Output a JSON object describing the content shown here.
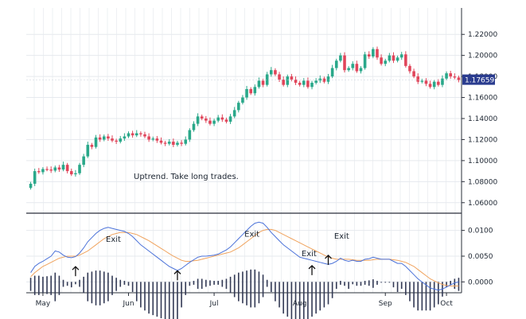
{
  "chart_data": [
    {
      "type": "candlestick",
      "annotation": "Uptrend. Take long trades.",
      "ylim": [
        1.05,
        1.23
      ],
      "yticks": [
        "1.22000",
        "1.20000",
        "1.18000",
        "1.16000",
        "1.14000",
        "1.12000",
        "1.10000",
        "1.08000",
        "1.06000"
      ],
      "yticks_val": [
        1.22,
        1.2,
        1.18,
        1.16,
        1.14,
        1.12,
        1.1,
        1.08,
        1.06
      ],
      "last_price_label": "1.17659",
      "last_price": 1.17659,
      "x_labels": [
        "May",
        "Jun",
        "Jul",
        "Aug",
        "Sep",
        "Oct"
      ],
      "grid": true,
      "colors": {
        "up": "#2aa88a",
        "down": "#e0455a",
        "badge": "#2a3c8f"
      },
      "close": [
        1.078,
        1.09,
        1.089,
        1.092,
        1.0915,
        1.0905,
        1.0935,
        1.0915,
        1.096,
        1.09,
        1.087,
        1.088,
        1.096,
        1.104,
        1.115,
        1.113,
        1.122,
        1.12,
        1.123,
        1.121,
        1.119,
        1.118,
        1.121,
        1.123,
        1.126,
        1.124,
        1.126,
        1.125,
        1.123,
        1.12,
        1.121,
        1.119,
        1.117,
        1.116,
        1.118,
        1.115,
        1.117,
        1.116,
        1.12,
        1.129,
        1.135,
        1.142,
        1.14,
        1.138,
        1.135,
        1.138,
        1.141,
        1.139,
        1.137,
        1.142,
        1.148,
        1.155,
        1.16,
        1.168,
        1.164,
        1.17,
        1.176,
        1.172,
        1.182,
        1.186,
        1.182,
        1.177,
        1.172,
        1.18,
        1.177,
        1.174,
        1.172,
        1.176,
        1.17,
        1.174,
        1.176,
        1.178,
        1.175,
        1.18,
        1.188,
        1.195,
        1.2,
        1.186,
        1.188,
        1.192,
        1.185,
        1.188,
        1.201,
        1.199,
        1.206,
        1.198,
        1.192,
        1.195,
        1.2,
        1.195,
        1.198,
        1.201,
        1.19,
        1.185,
        1.18,
        1.175,
        1.176,
        1.173,
        1.17,
        1.175,
        1.172,
        1.178,
        1.183,
        1.18,
        1.179,
        1.1766
      ],
      "macd_ylim": [
        -0.0018,
        0.0118
      ],
      "macd_yticks": [
        "0.0100",
        "0.0050",
        "0.0000"
      ],
      "macd_yticks_val": [
        0.01,
        0.005,
        0.0
      ],
      "macd_colors": {
        "macd": "#4b72d9",
        "signal": "#f0a35e",
        "hist": "#333a55"
      },
      "macd": [
        0.0018,
        0.003,
        0.0036,
        0.004,
        0.0045,
        0.005,
        0.006,
        0.0058,
        0.0052,
        0.0048,
        0.0047,
        0.0049,
        0.0056,
        0.0066,
        0.0078,
        0.0086,
        0.0094,
        0.01,
        0.0104,
        0.0106,
        0.0104,
        0.0102,
        0.01,
        0.0098,
        0.0094,
        0.0088,
        0.008,
        0.0072,
        0.0066,
        0.006,
        0.0054,
        0.0048,
        0.0042,
        0.0036,
        0.003,
        0.0026,
        0.0022,
        0.0026,
        0.0032,
        0.0038,
        0.0043,
        0.0048,
        0.005,
        0.005,
        0.0051,
        0.0052,
        0.0054,
        0.0058,
        0.0062,
        0.0068,
        0.0076,
        0.0084,
        0.0092,
        0.01,
        0.0108,
        0.0114,
        0.0116,
        0.0114,
        0.0106,
        0.0096,
        0.0088,
        0.008,
        0.0072,
        0.0066,
        0.006,
        0.0054,
        0.0048,
        0.0046,
        0.0044,
        0.0042,
        0.004,
        0.0038,
        0.0036,
        0.0034,
        0.0036,
        0.004,
        0.0046,
        0.0042,
        0.004,
        0.0042,
        0.004,
        0.004,
        0.0044,
        0.0045,
        0.0048,
        0.0046,
        0.0044,
        0.0044,
        0.0044,
        0.004,
        0.0036,
        0.0036,
        0.003,
        0.0022,
        0.0014,
        0.0006,
        0.0,
        -0.0006,
        -0.0012,
        -0.0014,
        -0.0016,
        -0.0014,
        -0.001,
        -0.0006,
        -0.0002,
        0.0
      ],
      "signal": [
        0.001,
        0.0018,
        0.0024,
        0.003,
        0.0034,
        0.0038,
        0.0042,
        0.0046,
        0.0048,
        0.005,
        0.005,
        0.005,
        0.0052,
        0.0056,
        0.006,
        0.0066,
        0.0072,
        0.0078,
        0.0084,
        0.0088,
        0.0092,
        0.0094,
        0.0096,
        0.0096,
        0.0096,
        0.0094,
        0.0092,
        0.0088,
        0.0084,
        0.008,
        0.0075,
        0.007,
        0.0065,
        0.006,
        0.0055,
        0.005,
        0.0046,
        0.0042,
        0.004,
        0.004,
        0.0041,
        0.0042,
        0.0044,
        0.0046,
        0.0048,
        0.005,
        0.0052,
        0.0054,
        0.0056,
        0.0058,
        0.0062,
        0.0066,
        0.0072,
        0.0078,
        0.0084,
        0.009,
        0.0096,
        0.01,
        0.0102,
        0.0102,
        0.01,
        0.0096,
        0.0092,
        0.0088,
        0.0084,
        0.008,
        0.0076,
        0.0072,
        0.0068,
        0.0064,
        0.006,
        0.0056,
        0.0052,
        0.0048,
        0.0046,
        0.0044,
        0.0044,
        0.0044,
        0.0044,
        0.0043,
        0.0042,
        0.0042,
        0.0042,
        0.0042,
        0.0043,
        0.0044,
        0.0044,
        0.0044,
        0.0044,
        0.0043,
        0.0042,
        0.004,
        0.0038,
        0.0034,
        0.003,
        0.0024,
        0.0018,
        0.0012,
        0.0006,
        0.0002,
        -0.0002,
        -0.0005,
        -0.0007,
        -0.0008,
        -0.0008,
        -0.0008
      ],
      "annotations": [
        {
          "text": "Exit",
          "index": 20,
          "value": 0.0078
        },
        {
          "text": "Exit",
          "index": 54,
          "value": 0.0088
        },
        {
          "text": "Exit",
          "index": 68,
          "value": 0.005
        },
        {
          "text": "Exit",
          "index": 76,
          "value": 0.0084
        }
      ],
      "arrows": [
        {
          "index": 11,
          "value": 0.0008
        },
        {
          "index": 36,
          "value": 0.0
        },
        {
          "index": 69,
          "value": 0.001
        },
        {
          "index": 73,
          "value": 0.003
        }
      ]
    }
  ]
}
